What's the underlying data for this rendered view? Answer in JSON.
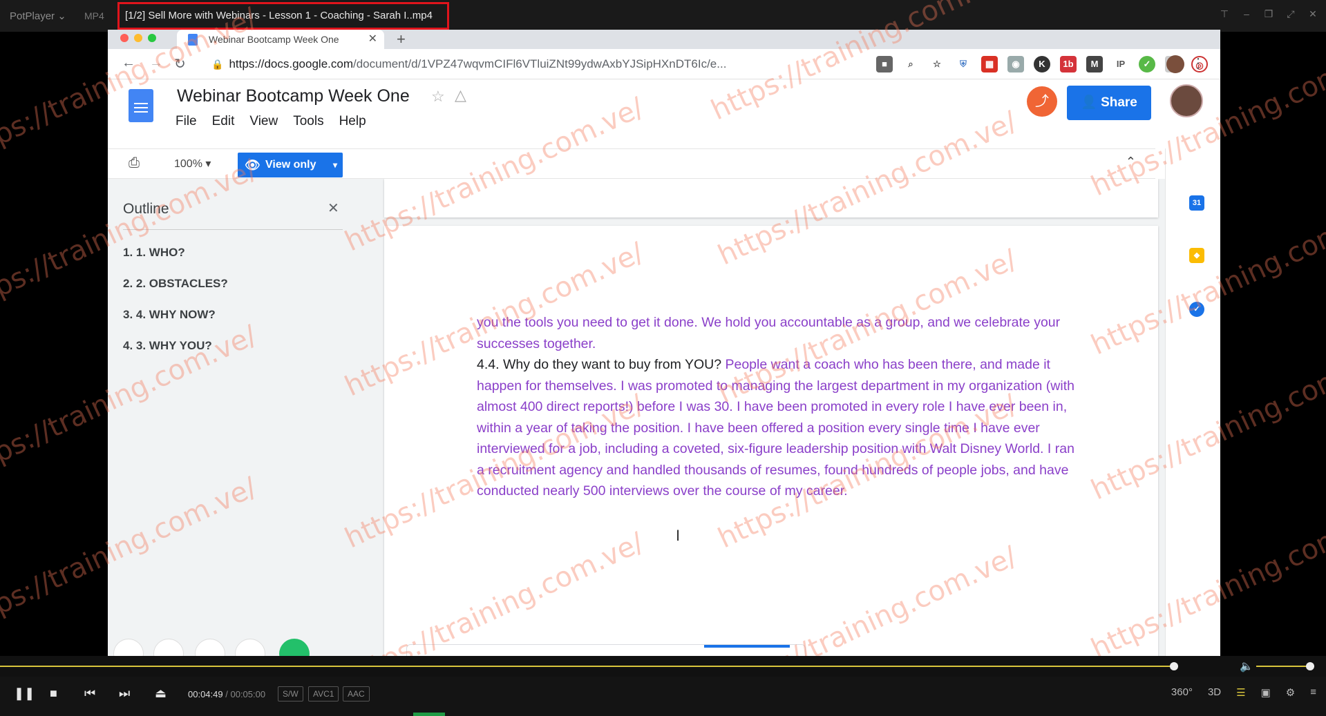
{
  "player": {
    "brand": "PotPlayer ⌄",
    "format": "MP4",
    "title": "[1/2] Sell More with Webinars - Lesson 1 - Coaching - Sarah I..mp4",
    "time_current": "00:04:49",
    "time_sep": "/",
    "time_total": "00:05:00",
    "tag_sw": "S/W",
    "tag_codec": "AVC1",
    "tag_audio": "AAC",
    "tag_360": "360°",
    "tag_3d": "3D",
    "progress": 0.964
  },
  "browser": {
    "tab_title": "Webinar Bootcamp Week One",
    "url_host": "https://docs.google.com",
    "url_path": "/document/d/1VPZ47wqvmCIFl6VTluiZNt99ydwAxbYJSipHXnDT6Ic/e..."
  },
  "docs": {
    "title": "Webinar Bootcamp Week One",
    "menu": [
      "File",
      "Edit",
      "View",
      "Tools",
      "Help"
    ],
    "zoom": "100%",
    "view_only": "View only",
    "share": "Share"
  },
  "outline": {
    "title": "Outline",
    "items": [
      "1. 1. WHO?",
      "2. 2. OBSTACLES?",
      "3. 4. WHY NOW?",
      "4. 3. WHY YOU?"
    ]
  },
  "document": {
    "para1": "you the tools you need to get it done. We hold you accountable as a group, and we celebrate your successes together.",
    "heading": "4.4. Why do they want to buy from YOU?",
    "para2": " People want a coach who has been there, and made it happen for themselves. I was promoted to managing the largest department in my organization (with almost 400 direct reports!) before I was 30. I have been promoted in every role I have ever been in, within a year of taking the position. I have been offered a position every single time I have ever interviewed for a job, including a coveted, six-figure leadership position with Walt Disney World. I ran a recruitment agency and handled thousands of resumes, found hundreds of people jobs, and have conducted nearly 500 interviews over the course of my career."
  },
  "watermark": "https://training.com.ve/",
  "colors": {
    "accent": "#1a73e8",
    "doc_text": "#8a3fc9",
    "highlight_border": "#e0141c",
    "seek": "#d8c53c"
  }
}
